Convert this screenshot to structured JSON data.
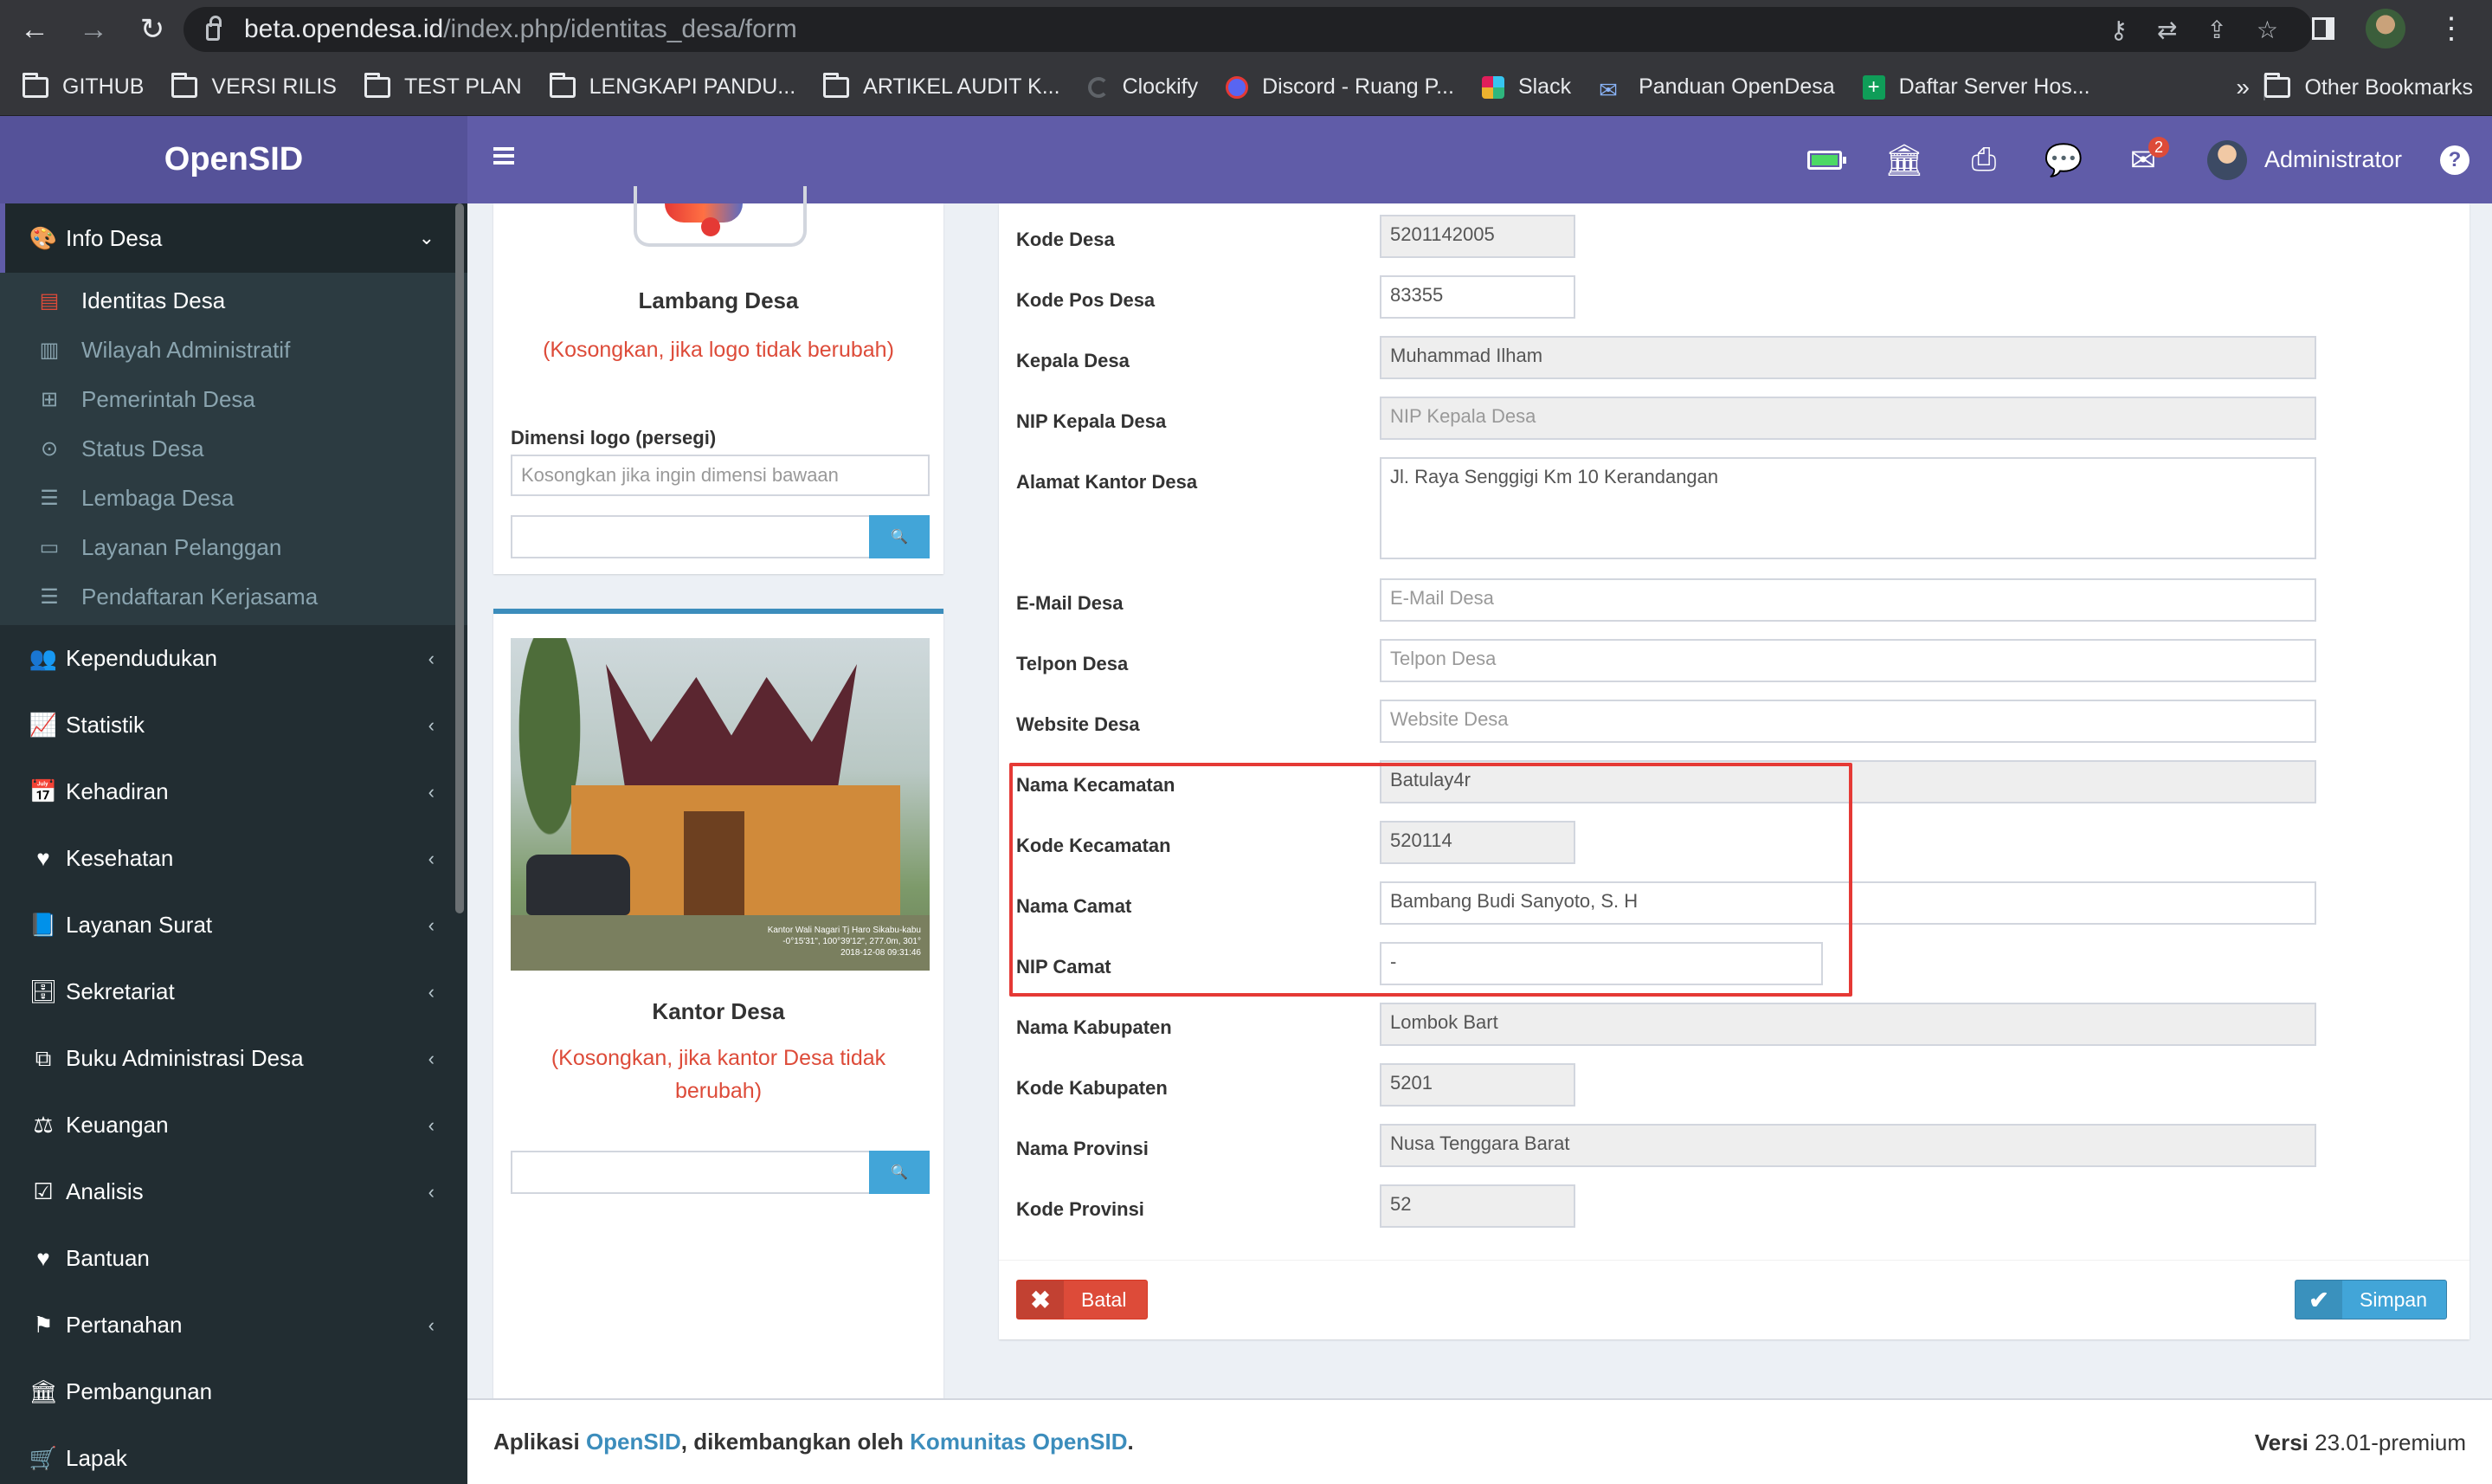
{
  "browser": {
    "url_host": "beta.opendesa.id",
    "url_path": "/index.php/identitas_desa/form",
    "bookmarks": [
      "GITHUB",
      "VERSI RILIS",
      "TEST PLAN",
      "LENGKAPI PANDU...",
      "ARTIKEL AUDIT K...",
      "Clockify",
      "Discord - Ruang P...",
      "Slack",
      "Panduan OpenDesa",
      "Daftar Server Hos..."
    ],
    "more": "»",
    "other_bookmarks": "Other Bookmarks"
  },
  "header": {
    "brand": "OpenSID",
    "notification_count": "2",
    "user_name": "Administrator"
  },
  "sidebar": {
    "active_section": "Info Desa",
    "sub_items": [
      "Identitas Desa",
      "Wilayah Administratif",
      "Pemerintah Desa",
      "Status Desa",
      "Lembaga Desa",
      "Layanan Pelanggan",
      "Pendaftaran Kerjasama"
    ],
    "items": [
      "Kependudukan",
      "Statistik",
      "Kehadiran",
      "Kesehatan",
      "Layanan Surat",
      "Sekretariat",
      "Buku Administrasi Desa",
      "Keuangan",
      "Analisis",
      "Bantuan",
      "Pertanahan",
      "Pembangunan",
      "Lapak"
    ]
  },
  "logo_card": {
    "title": "Lambang Desa",
    "hint": "(Kosongkan, jika logo tidak berubah)",
    "dim_label": "Dimensi logo (persegi)",
    "dim_placeholder": "Kosongkan jika ingin dimensi bawaan"
  },
  "kantor_card": {
    "title": "Kantor Desa",
    "hint": "(Kosongkan, jika kantor Desa tidak berubah)",
    "photo_caption_1": "Kantor Wali Nagari Tj Haro Sikabu-kabu",
    "photo_caption_2": "-0°15'31\", 100°39'12\", 277.0m, 301°",
    "photo_caption_3": "2018-12-08 09:31:46"
  },
  "form": {
    "fields": [
      {
        "label": "Kode Desa",
        "value": "5201142005"
      },
      {
        "label": "Kode Pos Desa",
        "value": "83355"
      },
      {
        "label": "Kepala Desa",
        "value": "Muhammad Ilham"
      },
      {
        "label": "NIP Kepala Desa",
        "value": "NIP Kepala Desa"
      },
      {
        "label": "Alamat Kantor Desa",
        "value": "Jl. Raya Senggigi Km 10 Kerandangan"
      },
      {
        "label": "E-Mail Desa",
        "value": "E-Mail Desa"
      },
      {
        "label": "Telpon Desa",
        "value": "Telpon Desa"
      },
      {
        "label": "Website Desa",
        "value": "Website Desa"
      },
      {
        "label": "Nama Kecamatan",
        "value": "Batulay4r"
      },
      {
        "label": "Kode Kecamatan",
        "value": "520114"
      },
      {
        "label": "Nama Camat",
        "value": "Bambang Budi Sanyoto, S. H"
      },
      {
        "label": "NIP Camat",
        "value": "-"
      },
      {
        "label": "Nama Kabupaten",
        "value": "Lombok Bart"
      },
      {
        "label": "Kode Kabupaten",
        "value": "5201"
      },
      {
        "label": "Nama Provinsi",
        "value": "Nusa Tenggara Barat"
      },
      {
        "label": "Kode Provinsi",
        "value": "52"
      }
    ],
    "cancel_label": "Batal",
    "save_label": "Simpan"
  },
  "footer": {
    "prefix": "Aplikasi",
    "app_link": "OpenSID",
    "middle": ", dikembangkan oleh",
    "community_link": "Komunitas OpenSID",
    "suffix": ".",
    "version_label": "Versi",
    "version": "23.01-premium"
  },
  "colors": {
    "header": "#605ca8",
    "sidebar": "#222d32",
    "danger": "#dd4b39",
    "primary": "#3c8dbc",
    "highlight": "#e53935"
  }
}
